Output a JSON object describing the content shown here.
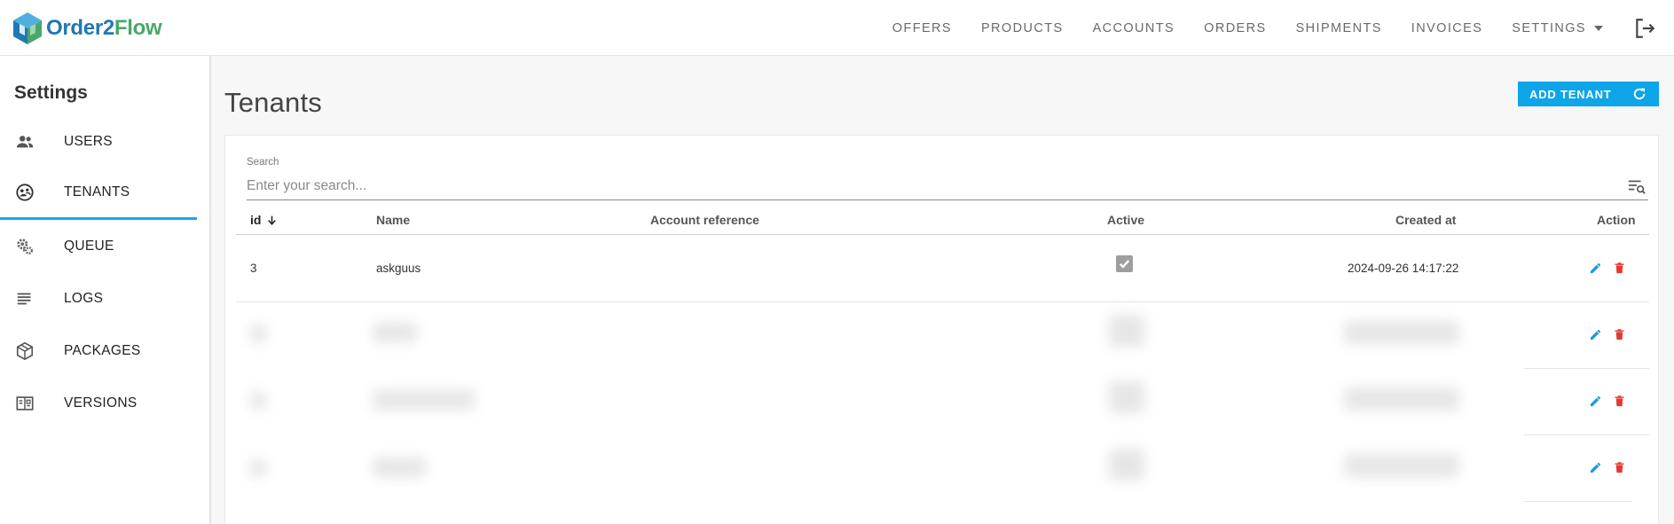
{
  "app": {
    "logo": {
      "part1": "Order",
      "part2": "2",
      "part3": "Flow"
    }
  },
  "nav": {
    "items": [
      "OFFERS",
      "PRODUCTS",
      "ACCOUNTS",
      "ORDERS",
      "SHIPMENTS",
      "INVOICES",
      "SETTINGS"
    ]
  },
  "sidebar": {
    "title": "Settings",
    "items": [
      {
        "label": "USERS",
        "icon": "users-icon"
      },
      {
        "label": "TENANTS",
        "icon": "tenants-icon",
        "active": true
      },
      {
        "label": "QUEUE",
        "icon": "queue-gears-icon"
      },
      {
        "label": "LOGS",
        "icon": "logs-list-icon"
      },
      {
        "label": "PACKAGES",
        "icon": "package-box-icon"
      },
      {
        "label": "VERSIONS",
        "icon": "versions-icon"
      }
    ]
  },
  "main": {
    "title": "Tenants",
    "add_button": "ADD TENANT",
    "search": {
      "label": "Search",
      "placeholder": "Enter your search..."
    },
    "table": {
      "columns": [
        "id",
        "Name",
        "Account reference",
        "Active",
        "Created at",
        "Action"
      ],
      "rows": [
        {
          "id": "3",
          "name": "askguus",
          "account_reference": "",
          "active": true,
          "created_at": "2024-09-26 14:17:22"
        }
      ]
    }
  },
  "colors": {
    "accent": "#0ea5e9",
    "edit": "#1a9be0",
    "delete": "#e53935"
  }
}
